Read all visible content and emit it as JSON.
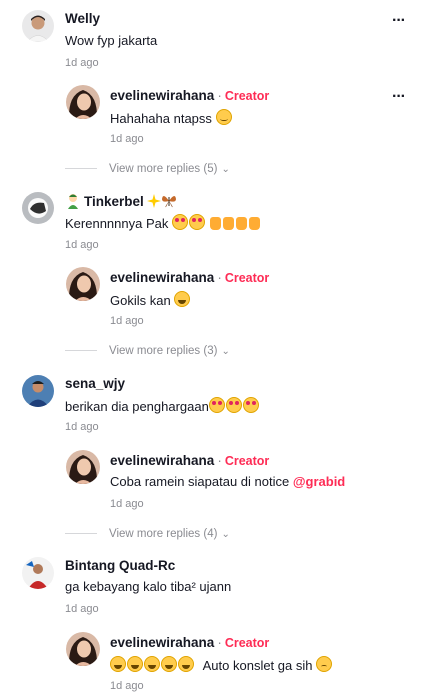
{
  "comments": [
    {
      "user": "Welly",
      "text": "Wow fyp jakarta",
      "time": "1d ago",
      "reply": {
        "user": "evelinewirahana",
        "badge_sep": "·",
        "badge": "Creator",
        "text": "Hahahaha ntapss",
        "time": "1d ago"
      },
      "more": "View more replies (5)"
    },
    {
      "user": "Tinkerbel",
      "text": "Kerennnnnya Pak",
      "time": "1d ago",
      "reply": {
        "user": "evelinewirahana",
        "badge_sep": "·",
        "badge": "Creator",
        "text": "Gokils kan",
        "time": "1d ago"
      },
      "more": "View more replies (3)"
    },
    {
      "user": "sena_wjy",
      "text": "berikan dia penghargaan",
      "time": "1d ago",
      "reply": {
        "user": "evelinewirahana",
        "badge_sep": "·",
        "badge": "Creator",
        "text": "Coba ramein siapatau di notice ",
        "mention": "@grabid",
        "time": "1d ago"
      },
      "more": "View more replies (4)"
    },
    {
      "user": "Bintang Quad-Rc",
      "text": "ga kebayang kalo tiba² ujann",
      "time": "1d ago",
      "reply": {
        "user": "evelinewirahana",
        "badge_sep": "·",
        "badge": "Creator",
        "text": "Auto konslet ga sih",
        "time": "1d ago"
      }
    }
  ],
  "menu_icon": "more-horizontal-icon",
  "colors": {
    "accent": "#fe2c55",
    "muted": "#8a8b91",
    "text": "#161823"
  }
}
